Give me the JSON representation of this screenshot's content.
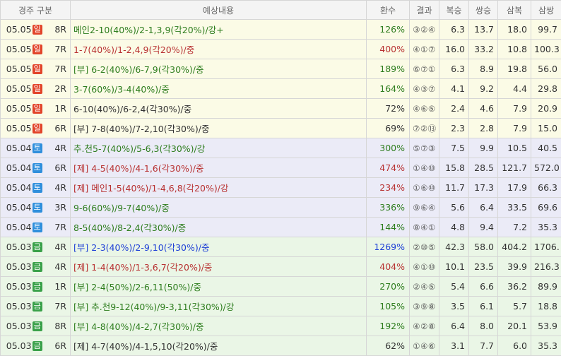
{
  "headers": {
    "race": "경주 구분",
    "content": "예상내용",
    "return": "환수",
    "result": "결과",
    "bokseung": "복승",
    "ssangseung": "쌍승",
    "sambok": "삼복",
    "samssang": "삼쌍"
  },
  "colors": {
    "sun_row_bg": "#fbfbe6",
    "sat_row_bg": "#ebebf7",
    "fri_row_bg": "#eaf6e6",
    "sun_badge": "#e2442a",
    "sat_badge": "#2f8fdc",
    "fri_badge": "#3aa14a",
    "green_text": "#2e7d1e",
    "red_text": "#b83232",
    "blue_text": "#1d3fd6"
  },
  "rows": [
    {
      "date": "05.05",
      "day": "일",
      "race": "8R",
      "content": "메인2-10(40%)/2-1,3,9(각20%)/강+",
      "ret": "126%",
      "result": "③②④",
      "bokseung": "6.3",
      "ssangseung": "13.7",
      "sambok": "18.0",
      "samssang": "99.7",
      "color": "c-green",
      "group": "sun"
    },
    {
      "date": "05.05",
      "day": "일",
      "race": "7R",
      "content": "1-7(40%)/1-2,4,9(각20%)/중",
      "ret": "400%",
      "result": "④①⑦",
      "bokseung": "16.0",
      "ssangseung": "33.2",
      "sambok": "10.8",
      "samssang": "100.3",
      "color": "c-red",
      "group": "sun"
    },
    {
      "date": "05.05",
      "day": "일",
      "race": "7R",
      "content": "[부] 6-2(40%)/6-7,9(각30%)/중",
      "ret": "189%",
      "result": "⑥⑦①",
      "bokseung": "6.3",
      "ssangseung": "8.9",
      "sambok": "19.8",
      "samssang": "56.0",
      "color": "c-green",
      "group": "sun"
    },
    {
      "date": "05.05",
      "day": "일",
      "race": "2R",
      "content": "3-7(60%)/3-4(40%)/중",
      "ret": "164%",
      "result": "④③⑦",
      "bokseung": "4.1",
      "ssangseung": "9.2",
      "sambok": "4.4",
      "samssang": "29.8",
      "color": "c-green",
      "group": "sun"
    },
    {
      "date": "05.05",
      "day": "일",
      "race": "1R",
      "content": "6-10(40%)/6-2,4(각30%)/중",
      "ret": "72%",
      "result": "④⑥⑤",
      "bokseung": "2.4",
      "ssangseung": "4.6",
      "sambok": "7.9",
      "samssang": "20.9",
      "color": "c-dark",
      "group": "sun"
    },
    {
      "date": "05.05",
      "day": "일",
      "race": "6R",
      "content": "[부] 7-8(40%)/7-2,10(각30%)/중",
      "ret": "69%",
      "result": "⑦②⑬",
      "bokseung": "2.3",
      "ssangseung": "2.8",
      "sambok": "7.9",
      "samssang": "15.0",
      "color": "c-dark",
      "group": "sun"
    },
    {
      "date": "05.04",
      "day": "토",
      "race": "4R",
      "content": "추.천5-7(40%)/5-6,3(각30%)/강",
      "ret": "300%",
      "result": "⑤⑦③",
      "bokseung": "7.5",
      "ssangseung": "9.9",
      "sambok": "10.5",
      "samssang": "40.5",
      "color": "c-green",
      "group": "sat"
    },
    {
      "date": "05.04",
      "day": "토",
      "race": "6R",
      "content": "[제] 4-5(40%)/4-1,6(각30%)/중",
      "ret": "474%",
      "result": "①④⑩",
      "bokseung": "15.8",
      "ssangseung": "28.5",
      "sambok": "121.7",
      "samssang": "572.0",
      "color": "c-red",
      "group": "sat"
    },
    {
      "date": "05.04",
      "day": "토",
      "race": "4R",
      "content": "[제] 메인1-5(40%)/1-4,6,8(각20%)/강",
      "ret": "234%",
      "result": "①⑥⑩",
      "bokseung": "11.7",
      "ssangseung": "17.3",
      "sambok": "17.9",
      "samssang": "66.3",
      "color": "c-red",
      "group": "sat"
    },
    {
      "date": "05.04",
      "day": "토",
      "race": "3R",
      "content": "9-6(60%)/9-7(40%)/중",
      "ret": "336%",
      "result": "⑨⑥④",
      "bokseung": "5.6",
      "ssangseung": "6.4",
      "sambok": "33.5",
      "samssang": "69.6",
      "color": "c-green",
      "group": "sat"
    },
    {
      "date": "05.04",
      "day": "토",
      "race": "7R",
      "content": "8-5(40%)/8-2,4(각30%)/중",
      "ret": "144%",
      "result": "⑧④①",
      "bokseung": "4.8",
      "ssangseung": "9.4",
      "sambok": "7.2",
      "samssang": "35.3",
      "color": "c-green",
      "group": "sat"
    },
    {
      "date": "05.03",
      "day": "금",
      "race": "4R",
      "content": "[부] 2-3(40%)/2-9,10(각30%)/중",
      "ret": "1269%",
      "result": "②⑩⑤",
      "bokseung": "42.3",
      "ssangseung": "58.0",
      "sambok": "404.2",
      "samssang": "1706.",
      "color": "c-blue",
      "group": "fri"
    },
    {
      "date": "05.03",
      "day": "금",
      "race": "4R",
      "content": "[제] 1-4(40%)/1-3,6,7(각20%)/중",
      "ret": "404%",
      "result": "④①⑩",
      "bokseung": "10.1",
      "ssangseung": "23.5",
      "sambok": "39.9",
      "samssang": "216.3",
      "color": "c-red",
      "group": "fri"
    },
    {
      "date": "05.03",
      "day": "금",
      "race": "1R",
      "content": "[부] 2-4(50%)/2-6,11(50%)/중",
      "ret": "270%",
      "result": "②④⑤",
      "bokseung": "5.4",
      "ssangseung": "6.6",
      "sambok": "36.2",
      "samssang": "89.9",
      "color": "c-green",
      "group": "fri"
    },
    {
      "date": "05.03",
      "day": "금",
      "race": "7R",
      "content": "[부] 추.천9-12(40%)/9-3,11(각30%)/강",
      "ret": "105%",
      "result": "③⑨⑧",
      "bokseung": "3.5",
      "ssangseung": "6.1",
      "sambok": "5.7",
      "samssang": "18.8",
      "color": "c-green",
      "group": "fri"
    },
    {
      "date": "05.03",
      "day": "금",
      "race": "8R",
      "content": "[부] 4-8(40%)/4-2,7(각30%)/중",
      "ret": "192%",
      "result": "④②⑧",
      "bokseung": "6.4",
      "ssangseung": "8.0",
      "sambok": "20.1",
      "samssang": "53.9",
      "color": "c-green",
      "group": "fri"
    },
    {
      "date": "05.03",
      "day": "금",
      "race": "6R",
      "content": "[제] 4-7(40%)/4-1,5,10(각20%)/중",
      "ret": "62%",
      "result": "①④⑥",
      "bokseung": "3.1",
      "ssangseung": "7.7",
      "sambok": "6.0",
      "samssang": "35.3",
      "color": "c-dark",
      "group": "fri"
    }
  ]
}
